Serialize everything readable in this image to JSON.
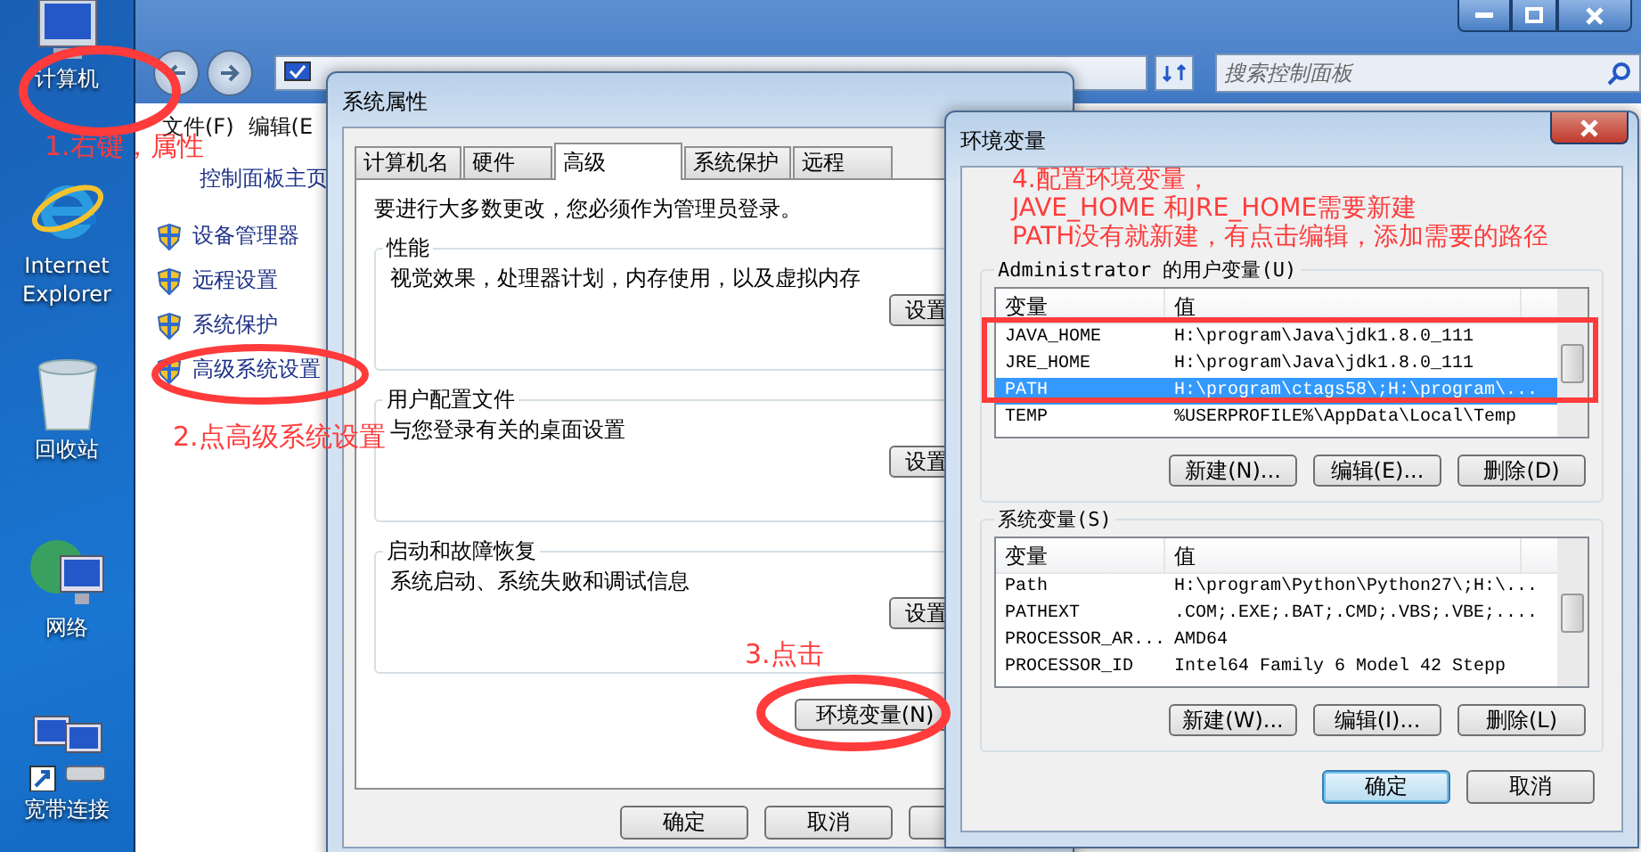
{
  "desktop_icons": [
    {
      "kind": "computer",
      "label": "计算机"
    },
    {
      "kind": "browser",
      "label": "Internet Explorer"
    },
    {
      "kind": "recycle",
      "label": "回收站"
    },
    {
      "kind": "network",
      "label": "网络"
    },
    {
      "kind": "broadband",
      "label": "宽带连接"
    }
  ],
  "control_panel": {
    "search": {
      "placeholder": "搜索控制面板"
    },
    "menu": [
      "文件(F)",
      "编辑(E"
    ],
    "sidebar": {
      "home": "控制面板主页",
      "items": [
        {
          "label": "设备管理器"
        },
        {
          "label": "远程设置"
        },
        {
          "label": "系统保护"
        },
        {
          "label": "高级系统设置"
        }
      ]
    }
  },
  "system_properties": {
    "title": "系统属性",
    "tabs": [
      {
        "label": "计算机名",
        "selected": false
      },
      {
        "label": "硬件",
        "selected": false
      },
      {
        "label": "高级",
        "selected": true
      },
      {
        "label": "系统保护",
        "selected": false
      },
      {
        "label": "远程",
        "selected": false
      }
    ],
    "notice": "要进行大多数更改，您必须作为管理员登录。",
    "groups": [
      {
        "title": "性能",
        "description": "视觉效果，处理器计划，内存使用，以及虚拟内存",
        "button": "设置"
      },
      {
        "title": "用户配置文件",
        "description": "与您登录有关的桌面设置",
        "button": "设置"
      },
      {
        "title": "启动和故障恢复",
        "description": "系统启动、系统失败和调试信息",
        "button": "设置"
      }
    ],
    "env_button": "环境变量(N)",
    "buttons": [
      "确定",
      "取消"
    ]
  },
  "environment_variables": {
    "title": "环境变量",
    "sections": [
      {
        "title": "Administrator 的用户变量(U)",
        "columns": [
          "变量",
          "值"
        ],
        "rows": [
          {
            "name": "JAVA_HOME",
            "value": "H:\\program\\Java\\jdk1.8.0_111",
            "selected": false
          },
          {
            "name": "JRE_HOME",
            "value": "H:\\program\\Java\\jdk1.8.0_111",
            "selected": false
          },
          {
            "name": "PATH",
            "value": "H:\\program\\ctags58\\;H:\\program\\...",
            "selected": true
          },
          {
            "name": "TEMP",
            "value": "%USERPROFILE%\\AppData\\Local\\Temp",
            "selected": false
          }
        ],
        "buttons": [
          "新建(N)...",
          "编辑(E)...",
          "删除(D)"
        ]
      },
      {
        "title": "系统变量(S)",
        "columns": [
          "变量",
          "值"
        ],
        "rows": [
          {
            "name": "Path",
            "value": "H:\\program\\Python\\Python27\\;H:\\...",
            "selected": false
          },
          {
            "name": "PATHEXT",
            "value": ".COM;.EXE;.BAT;.CMD;.VBS;.VBE;....",
            "selected": false
          },
          {
            "name": "PROCESSOR_AR...",
            "value": "AMD64",
            "selected": false
          },
          {
            "name": "PROCESSOR_ID",
            "value": "Intel64 Family 6 Model 42 Stepp",
            "selected": false
          }
        ],
        "buttons": [
          "新建(W)...",
          "编辑(I)...",
          "删除(L)"
        ]
      }
    ],
    "buttons": [
      {
        "label": "确定",
        "default": true
      },
      {
        "label": "取消",
        "default": false
      }
    ]
  },
  "annotations": [
    {
      "text": "1.右键，属性"
    },
    {
      "text": "2.点高级系统设置"
    },
    {
      "text": "3.点击"
    },
    {
      "text": "4.配置环境变量，"
    },
    {
      "text": "JAVE_HOME 和JRE_HOME需要新建"
    },
    {
      "text": "PATH没有就新建，有点击编辑，添加需要的路径"
    }
  ]
}
